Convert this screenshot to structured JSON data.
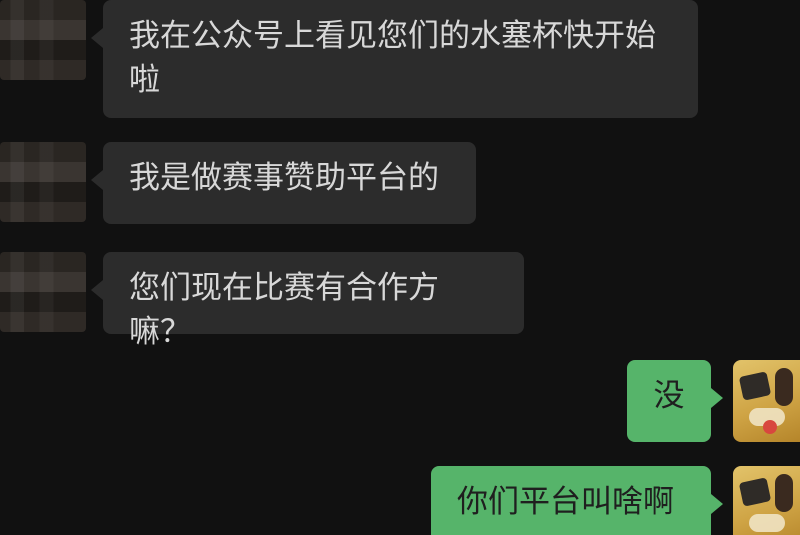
{
  "messages": [
    {
      "side": "left",
      "text": "我在公众号上看见您们的水塞杯快开始啦"
    },
    {
      "side": "left",
      "text": "我是做赛事赞助平台的"
    },
    {
      "side": "left",
      "text": "您们现在比赛有合作方嘛？"
    },
    {
      "side": "right",
      "text": "没"
    },
    {
      "side": "right",
      "text": "你们平台叫啥啊"
    }
  ]
}
